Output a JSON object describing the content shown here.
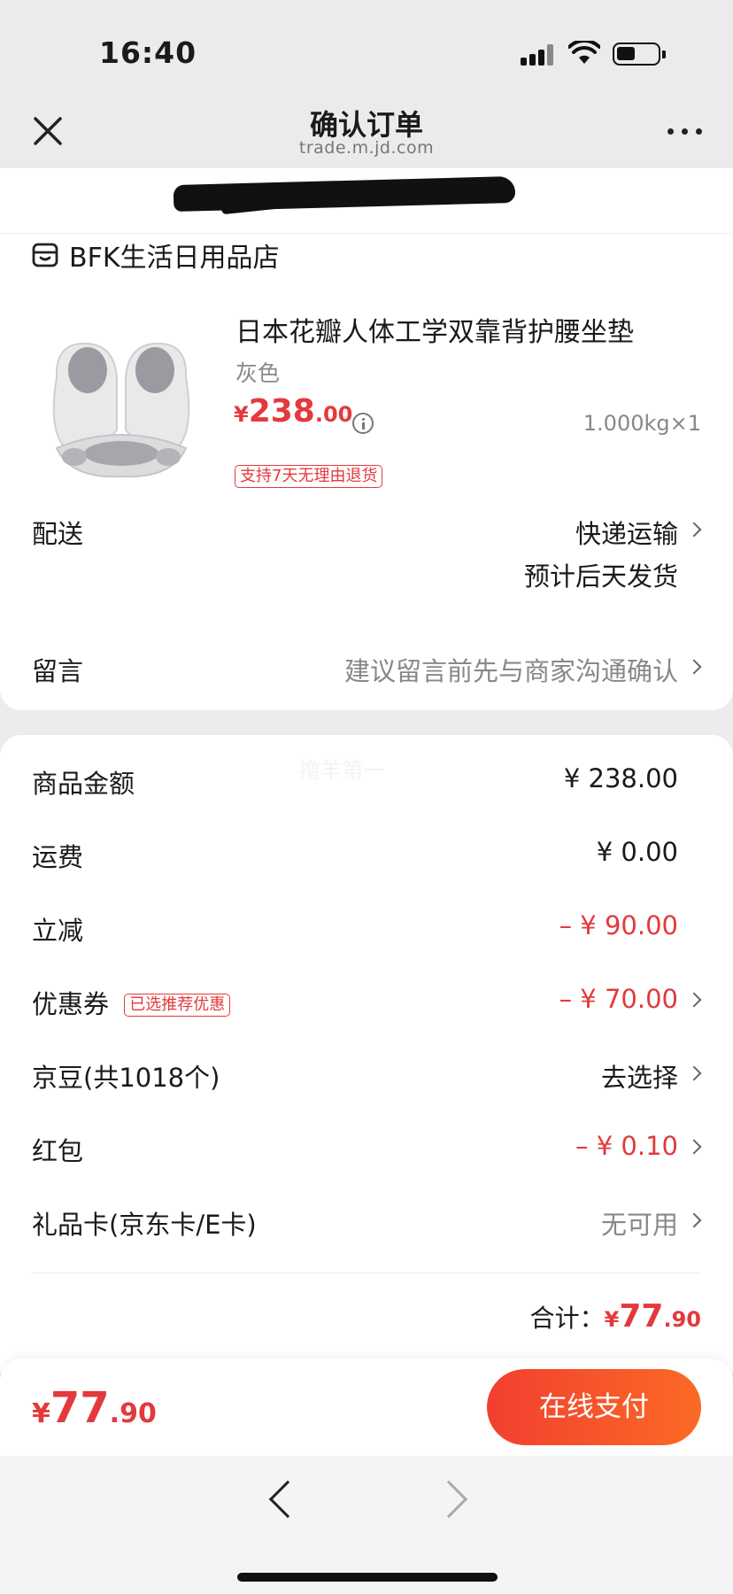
{
  "status": {
    "time": "16:40"
  },
  "nav": {
    "title": "确认订单",
    "subtitle": "trade.m.jd.com"
  },
  "shop": {
    "name": "BFK生活日用品店",
    "icon": "shop-icon"
  },
  "product": {
    "title": "日本花瓣人体工学双靠背护腰坐垫",
    "color": "灰色",
    "price_symbol": "¥",
    "price_int": "238",
    "price_dec": ".00",
    "weight_qty": "1.000kg×1",
    "tag": "支持7天无理由退货"
  },
  "delivery": {
    "label": "配送",
    "method": "快递运输",
    "eta": "预计后天发货"
  },
  "message": {
    "label": "留言",
    "placeholder": "建议留言前先与商家沟通确认"
  },
  "summary": {
    "goods_label": "商品金额",
    "goods_value": "¥ 238.00",
    "shipping_label": "运费",
    "shipping_value": "¥ 0.00",
    "discount_label": "立减",
    "discount_value": "– ¥ 90.00",
    "coupon_label": "优惠券",
    "coupon_tag": "已选推荐优惠",
    "coupon_value": "– ¥ 70.00",
    "beans_label": "京豆(共1018个)",
    "beans_value": "去选择",
    "redpack_label": "红包",
    "redpack_value": "– ¥ 0.10",
    "giftcard_label": "礼品卡(京东卡/E卡)",
    "giftcard_value": "无可用",
    "total_label": "合计：",
    "total_symbol": "¥",
    "total_int": "77",
    "total_dec": ".90",
    "watermark": "撸羊第一"
  },
  "paybar": {
    "symbol": "¥",
    "int": "77",
    "dec": ".90",
    "button": "在线支付"
  },
  "colors": {
    "accent": "#e4393c",
    "button_start": "#f23f30",
    "button_end": "#fb6a24"
  }
}
